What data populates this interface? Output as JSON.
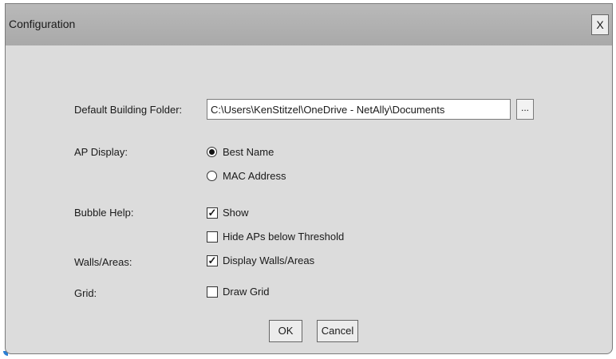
{
  "window": {
    "title": "Configuration",
    "close_label": "X"
  },
  "default_folder": {
    "label": "Default Building Folder:",
    "value": "C:\\Users\\KenStitzel\\OneDrive - NetAlly\\Documents",
    "browse_label": "..."
  },
  "ap_display": {
    "label": "AP Display:",
    "options": [
      {
        "label": "Best Name",
        "selected": true
      },
      {
        "label": "MAC Address",
        "selected": false
      }
    ]
  },
  "bubble_help": {
    "label": "Bubble Help:",
    "show": {
      "label": "Show",
      "checked": true
    },
    "hide_aps": {
      "label": "Hide APs below Threshold",
      "checked": false
    }
  },
  "walls_areas": {
    "label": "Walls/Areas:",
    "display": {
      "label": "Display Walls/Areas",
      "checked": true
    }
  },
  "grid": {
    "label": "Grid:",
    "draw": {
      "label": "Draw Grid",
      "checked": false
    }
  },
  "buttons": {
    "ok": "OK",
    "cancel": "Cancel"
  },
  "colors": {
    "titlebar": "#b0b0b0",
    "dialog_bg": "#dcdcdc",
    "accent_corner": "#2a7fd4"
  }
}
